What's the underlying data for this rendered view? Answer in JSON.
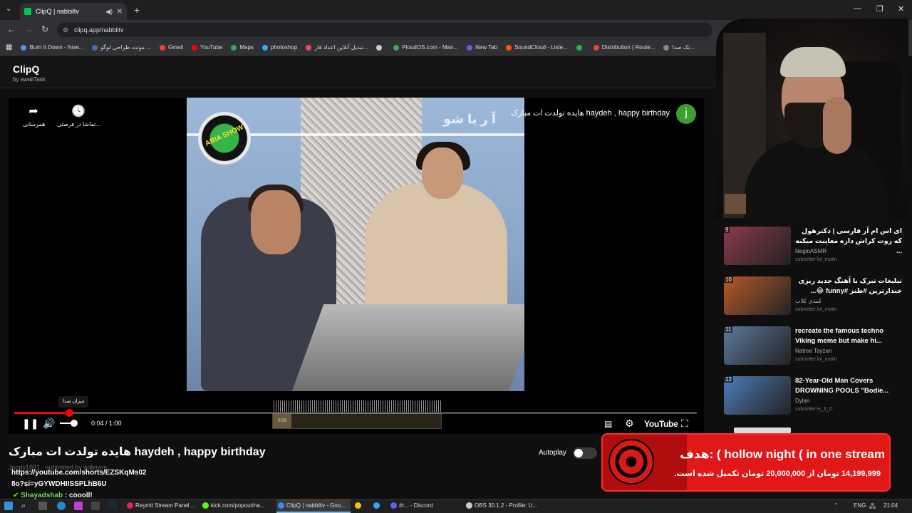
{
  "browser": {
    "tab_title": "ClipQ | nabbiltv",
    "url": "clipq.app/nabbiltv",
    "bookmarks": [
      {
        "label": "Burn It Down - Now...",
        "color": "#5a8dee"
      },
      {
        "label": "موتت طراحی لوگو ...",
        "color": "#4b6cb7"
      },
      {
        "label": "Gmail",
        "color": "#ea4335"
      },
      {
        "label": "YouTube",
        "color": "#ff0000"
      },
      {
        "label": "Maps",
        "color": "#34a853"
      },
      {
        "label": "photoshop",
        "color": "#31a8ff"
      },
      {
        "label": "تبدیل آنلاین اعداد فار...",
        "color": "#e94b5b"
      },
      {
        "label": "",
        "color": "#cccccc"
      },
      {
        "label": "PloudOS.com - Man...",
        "color": "#3aaa5c"
      },
      {
        "label": "New Tab",
        "color": "#6e5ae6"
      },
      {
        "label": "SoundCloud - Liste...",
        "color": "#ff5500"
      },
      {
        "label": "",
        "color": "#1db954"
      },
      {
        "label": "Distribution | Route...",
        "color": "#e8453c"
      },
      {
        "label": "تک صدا...",
        "color": "#888888"
      }
    ]
  },
  "app": {
    "title": "ClipQ",
    "subtitle": "by awaitTask"
  },
  "player": {
    "share_label": "همرسانی",
    "later_label": "تماشا در فرصتی...",
    "video_title": "هایده تولدت ات مبارک haydeh , happy birthday",
    "channel_initial": "j",
    "volume_tooltip": "میزان صدا",
    "time": "0:04 / 1:00",
    "youtube_label": "YouTube",
    "progress": 0.08,
    "volume": 0.7,
    "watermark": "آ ر یا شو",
    "logo_text": "ARIA SHOW",
    "storyboard_time": "0:03"
  },
  "below": {
    "title": "هایده تولدت ات مبارک haydeh , happy birthday",
    "meta": "Joody1981 · submitted by adleram",
    "autoplay_label": "Autoplay"
  },
  "chat": {
    "link_line1": "https://youtube.com/shorts/EZSKqMs02",
    "link_line2": "8o?si=yGYWDHIISSPLhB6U",
    "user": "Shayadshab",
    "message": ": coooll!"
  },
  "recommendations": [
    {
      "num": "9",
      "title": "ای اس ام آر فارسی | دکترهول که روت کراش داره معاینت میکنه ...",
      "channel": "NeginASMR",
      "submitter": "submitter lol_matin",
      "rtl": true,
      "color": "#8b3a4a"
    },
    {
      "num": "10",
      "title": "تبلیغات تبرک با آهنگ جدید ریزی خندارترین #طنز #funny 😂...",
      "channel": "کمدی کلاب",
      "submitter": "submitter lol_matin",
      "rtl": true,
      "color": "#b75a2a"
    },
    {
      "num": "11",
      "title": "recreate the famous techno Viking meme but make hi...",
      "channel": "Natree Tayzan",
      "submitter": "submitter lol_matin",
      "rtl": false,
      "color": "#5c7a9c"
    },
    {
      "num": "12",
      "title": "82-Year-Old Man Covers DROWNING POOLS \"Bodie...",
      "channel": "Dylan",
      "submitter": "submitter H_3_D",
      "rtl": false,
      "color": "#4d7db8"
    }
  ],
  "goal": {
    "title": "هدف: ( hollow night ( in one stream",
    "description": "14,199,999 تومان از 20,000,000 تومان تکمیل شده است."
  },
  "taskbar": {
    "items": [
      {
        "label": "Reymit Stream Panel ...",
        "color": "#e0245e"
      },
      {
        "label": "kick.com/popout/na...",
        "color": "#53fc18"
      },
      {
        "label": "ClipQ | nabbiltv - Goo...",
        "color": "#4285f4"
      },
      {
        "label": "",
        "color": "#f4c20d"
      },
      {
        "label": "",
        "color": "#31a8ff"
      },
      {
        "label": "#r... - Discord",
        "color": "#5865f2"
      },
      {
        "label": "OBS 30.1.2 - Profile: U...",
        "color": "#cccccc"
      }
    ],
    "lang": "ENG",
    "clock": "21:04"
  },
  "colors": {
    "accent_red": "#ff0000",
    "goal_red": "#e01818",
    "chat_user": "#7bd86f"
  }
}
